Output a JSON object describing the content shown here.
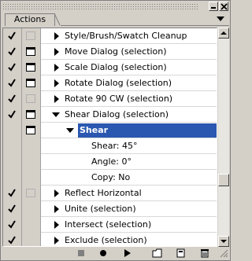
{
  "panel": {
    "tab_label": "Actions"
  },
  "actions": [
    {
      "label": "Style/Brush/Swatch Cleanup",
      "checked": true,
      "dialog": "empty",
      "expanded": false
    },
    {
      "label": "Move Dialog (selection)",
      "checked": true,
      "dialog": "on",
      "expanded": false
    },
    {
      "label": "Scale Dialog (selection)",
      "checked": true,
      "dialog": "on",
      "expanded": false
    },
    {
      "label": "Rotate Dialog (selection)",
      "checked": true,
      "dialog": "on",
      "expanded": false
    },
    {
      "label": "Rotate 90 CW (selection)",
      "checked": true,
      "dialog": "empty",
      "expanded": false
    },
    {
      "label": "Shear Dialog (selection)",
      "checked": true,
      "dialog": "on",
      "expanded": true
    }
  ],
  "selected_step": {
    "label": "Shear",
    "params": [
      "Shear: 45°",
      "Angle: 0°",
      "Copy: No"
    ]
  },
  "actions_after": [
    {
      "label": "Reflect Horizontal",
      "checked": true,
      "dialog": "empty"
    },
    {
      "label": "Unite (selection)",
      "checked": true,
      "dialog": "none"
    },
    {
      "label": "Intersect (selection)",
      "checked": true,
      "dialog": "none"
    },
    {
      "label": "Exclude (selection)",
      "checked": true,
      "dialog": "none"
    }
  ],
  "toolbar": {
    "buttons": [
      "stop-icon",
      "record-icon",
      "play-icon",
      "new-set-icon",
      "new-action-icon",
      "delete-icon"
    ]
  },
  "colors": {
    "selection": "#2a57b0",
    "panel_bg": "#d4d0c8"
  }
}
